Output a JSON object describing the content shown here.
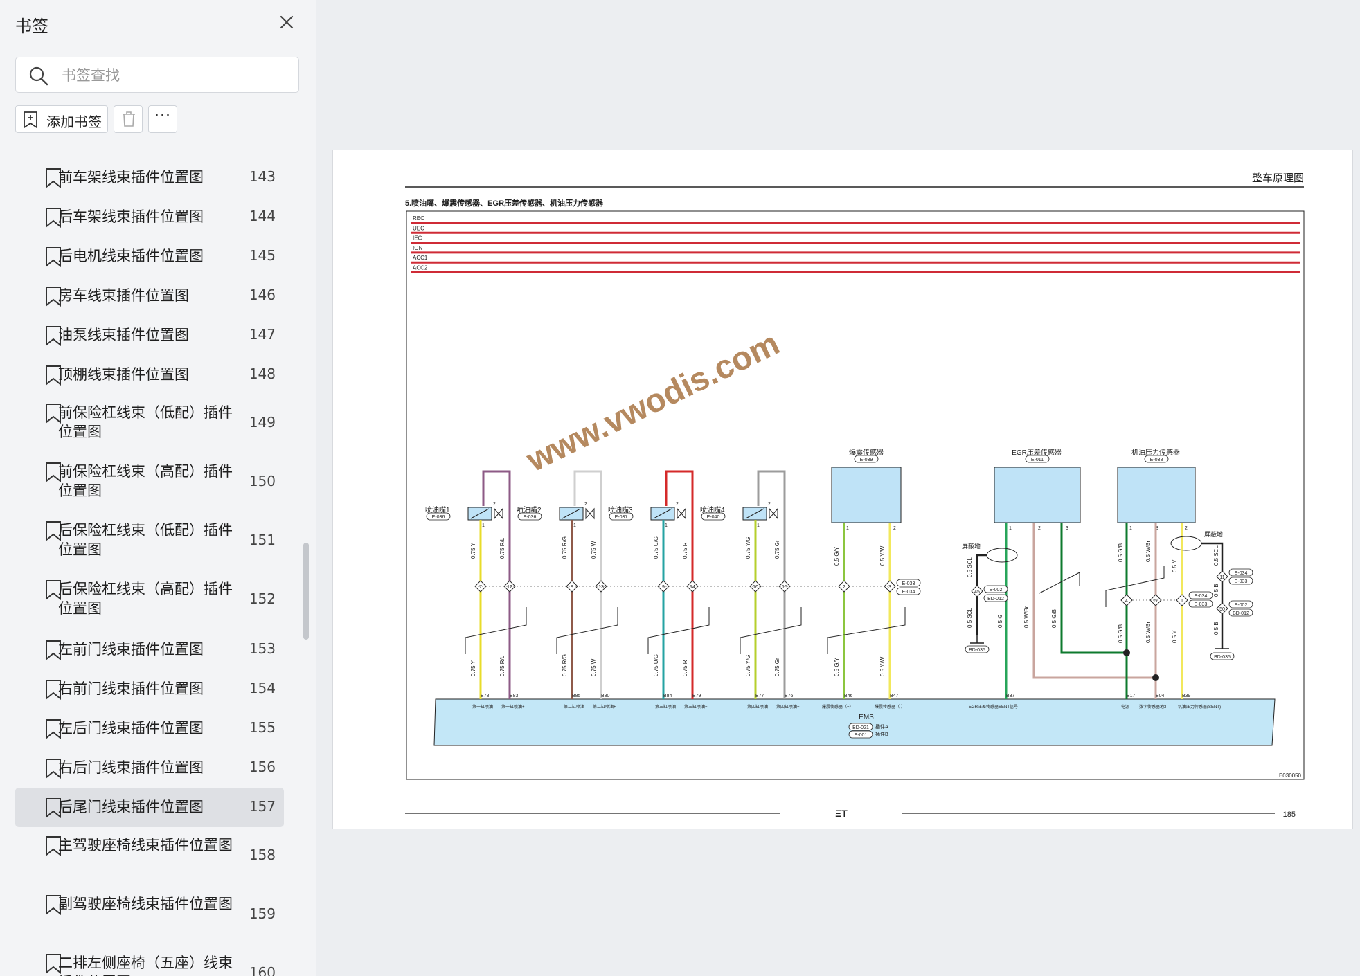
{
  "sidebar": {
    "title": "书签",
    "search_placeholder": "书签查找",
    "add_label": "添加书签",
    "more_label": "···",
    "items": [
      {
        "label": "前车架线束插件位置图",
        "page": "143"
      },
      {
        "label": "后车架线束插件位置图",
        "page": "144"
      },
      {
        "label": "后电机线束插件位置图",
        "page": "145"
      },
      {
        "label": "房车线束插件位置图",
        "page": "146"
      },
      {
        "label": "油泵线束插件位置图",
        "page": "147"
      },
      {
        "label": "顶棚线束插件位置图",
        "page": "148"
      },
      {
        "label": "前保险杠线束（低配）插件位置图",
        "page": "149"
      },
      {
        "label": "前保险杠线束（高配）插件位置图",
        "page": "150"
      },
      {
        "label": "后保险杠线束（低配）插件位置图",
        "page": "151"
      },
      {
        "label": "后保险杠线束（高配）插件位置图",
        "page": "152"
      },
      {
        "label": "左前门线束插件位置图",
        "page": "153"
      },
      {
        "label": "右前门线束插件位置图",
        "page": "154"
      },
      {
        "label": "左后门线束插件位置图",
        "page": "155"
      },
      {
        "label": "右后门线束插件位置图",
        "page": "156"
      },
      {
        "label": "后尾门线束插件位置图",
        "page": "157",
        "selected": true
      },
      {
        "label": "主驾驶座椅线束插件位置图",
        "page": "158"
      },
      {
        "label": "副驾驶座椅线束插件位置图",
        "page": "159"
      },
      {
        "label": "二排左侧座椅（五座）线束插件位置图",
        "page": "160"
      }
    ]
  },
  "document": {
    "header_title": "整车原理图",
    "section_title": "5.喷油嘴、爆震传感器、EGR压差传感器、机油压力传感器",
    "power_rails": [
      "REC",
      "UEC",
      "IEC",
      "IGN",
      "ACC1",
      "ACC2"
    ],
    "watermark": "www.vwodis.com",
    "diagram_id": "E030050",
    "page_number": "185",
    "footer_logo": "ΞΤ",
    "injectors": [
      {
        "name": "喷油嘴1",
        "conn": "E-036",
        "pin_top": "2",
        "pin_bottom": "1",
        "wire_a": "0.75 Y",
        "wire_b": "0.75 R/L",
        "mid_a": "7",
        "mid_b": "12",
        "ecu_a": "B78",
        "ecu_b": "B83",
        "func_a": "第一缸喷油-",
        "func_b": "第一缸喷油+"
      },
      {
        "name": "喷油嘴2",
        "conn": "E-036",
        "pin_top": "2",
        "pin_bottom": "1",
        "wire_a": "0.75 R/G",
        "wire_b": "0.75 W",
        "mid_a": "8",
        "mid_b": "13",
        "ecu_a": "B85",
        "ecu_b": "B80",
        "func_a": "第二缸喷油-",
        "func_b": "第二缸喷油+"
      },
      {
        "name": "喷油嘴3",
        "conn": "E-037",
        "pin_top": "2",
        "pin_bottom": "1",
        "wire_a": "0.75 U/G",
        "wire_b": "0.75 R",
        "mid_a": "9",
        "mid_b": "14",
        "ecu_a": "B84",
        "ecu_b": "B79",
        "func_a": "第三缸喷油-",
        "func_b": "第三缸喷油+"
      },
      {
        "name": "喷油嘴4",
        "conn": "E-040",
        "pin_top": "2",
        "pin_bottom": "1",
        "wire_a": "0.75 Y/G",
        "wire_b": "0.75 Gr",
        "mid_a": "10",
        "mid_b": "15",
        "ecu_a": "B77",
        "ecu_b": "B76",
        "func_a": "第四缸喷油-",
        "func_b": "第四缸喷油+"
      }
    ],
    "knock": {
      "name": "爆震传感器",
      "conn": "E-039",
      "pin1": "1",
      "pin2": "2",
      "wire_a": "0.5 G/Y",
      "wire_b": "0.5 Y/W",
      "mid_a": "2",
      "mid_b": "3",
      "mid_conn1": "E-033",
      "mid_conn2": "E-034",
      "ecu_a": "B46",
      "ecu_b": "B47",
      "func_a": "爆震传感器（+）",
      "func_b": "爆震传感器（-）"
    },
    "egr": {
      "name": "EGR压差传感器",
      "conn": "E-011",
      "pin1": "1",
      "pin2": "2",
      "pin3": "3",
      "wire_sig": "0.5 G",
      "wire_2": "0.5 W/Br",
      "wire_3": "0.5 G/B",
      "ecu": "B37",
      "func": "EGR压差传感器SENT信号",
      "shield": "屏蔽地",
      "shield_wire_a": "0.5 SCL",
      "shield_wire_b": "0.5 SCL",
      "shield_pin": "45",
      "shield_conn1": "E-002",
      "shield_conn2": "BD-012",
      "ground": "BD-035"
    },
    "oil": {
      "name": "机油压力传感器",
      "conn": "E-038",
      "pin1": "1",
      "pin2": "3",
      "pin3": "2",
      "wire_a": "0.5 G/B",
      "wire_b": "0.5 W/Br",
      "wire_c": "0.5 Y",
      "mid_a": "4",
      "mid_b": "5",
      "mid_c": "1",
      "mid_conn1": "E-034",
      "mid_conn2": "E-033",
      "ecu_a": "B17",
      "ecu_b": "B04",
      "ecu_c": "B39",
      "func_a": "电源",
      "func_b": "数字传感器地3",
      "func_c": "机油压力传感器(SENT)",
      "shield": "屏蔽地",
      "shield_wire_a": "0.5 SCL",
      "shield_wire_b": "0.5 B",
      "shield_wire_c": "0.5 B",
      "shield_pin_a": "11",
      "shield_pin_b": "50",
      "shield_conn_a1": "E-034",
      "shield_conn_a2": "E-033",
      "shield_conn_b1": "E-002",
      "shield_conn_b2": "BD-012",
      "ground": "BD-035"
    },
    "ems": {
      "name": "EMS",
      "conn1": "BD-021",
      "conn1_label": "插件A",
      "conn2": "E-001",
      "conn2_label": "插件B"
    }
  },
  "colors": {
    "rail": "#cf2b36",
    "sensor_fill": "#bfe3f7",
    "ems_fill": "#c3e7f7",
    "watermark": "#b5895f"
  }
}
